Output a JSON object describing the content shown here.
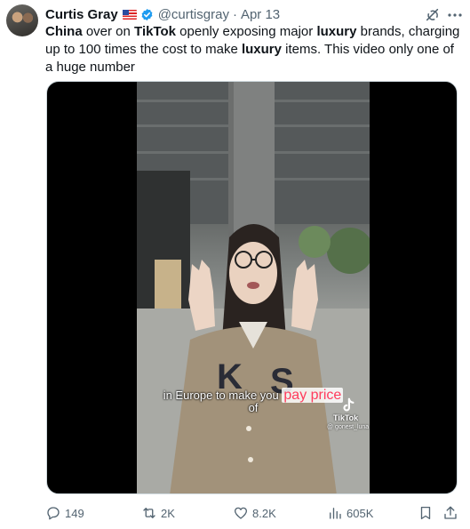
{
  "author": {
    "name": "Curtis Gray",
    "handle": "@curtisgray",
    "separator": "·",
    "date": "Apr 13",
    "flag_icon": "us-flag-icon",
    "verified_icon": "verified-badge-icon"
  },
  "tweet": {
    "segments": [
      {
        "text": "China",
        "bold": true
      },
      {
        "text": " over on ",
        "bold": false
      },
      {
        "text": "TikTok",
        "bold": true
      },
      {
        "text": " openly exposing major ",
        "bold": false
      },
      {
        "text": "luxury",
        "bold": true
      },
      {
        "text": " brands, charging up to 100 times the cost to make ",
        "bold": false
      },
      {
        "text": "luxury",
        "bold": true
      },
      {
        "text": " items. This video only one of a huge number",
        "bold": false
      }
    ]
  },
  "video": {
    "caption_part1": "in Europe to make you ",
    "caption_highlight": "pay price",
    "caption_part2": "of",
    "watermark_brand": "TikTok",
    "watermark_user": "@ gonest_luna"
  },
  "actions": {
    "replies": "149",
    "reposts": "2K",
    "likes": "8.2K",
    "views": "605K"
  },
  "colors": {
    "text": "#0f1419",
    "secondary": "#536471",
    "verified": "#1d9bf0",
    "highlight": "#ff3b5c"
  }
}
